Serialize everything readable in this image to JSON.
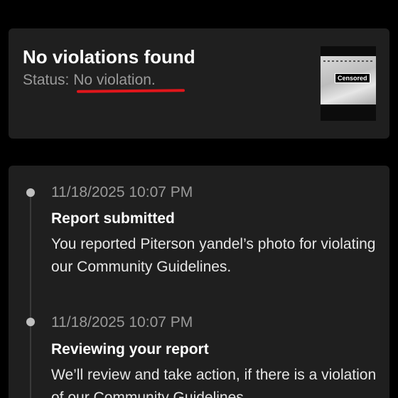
{
  "status_card": {
    "title": "No violations found",
    "status_prefix": "Status:",
    "status_value": " No violation.",
    "thumbnail_badge": "Censored",
    "underline_color": "#e0161b"
  },
  "timeline": {
    "items": [
      {
        "date": "11/18/2025 10:07 PM",
        "heading": "Report submitted",
        "body": "You reported Piterson yandel’s photo for violating our Community Guidelines."
      },
      {
        "date": "11/18/2025 10:07 PM",
        "heading": "Reviewing your report",
        "body": "We’ll review and take action, if there is a violation of our Community Guidelines."
      }
    ]
  }
}
